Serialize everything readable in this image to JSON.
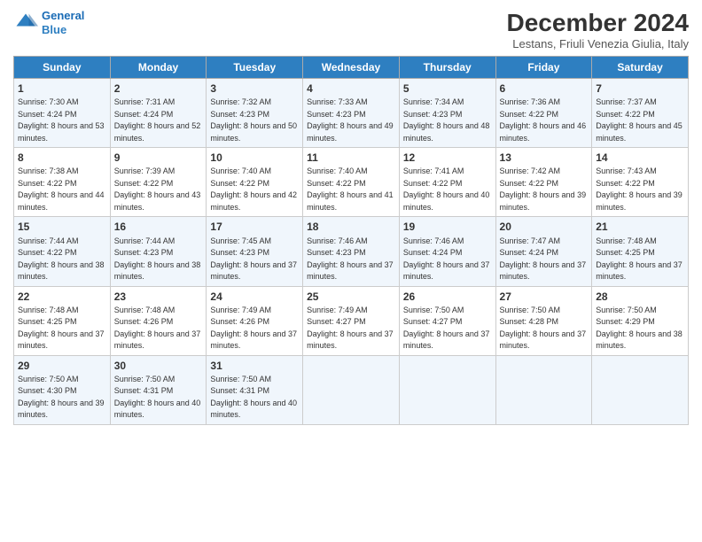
{
  "logo": {
    "line1": "General",
    "line2": "Blue"
  },
  "title": "December 2024",
  "subtitle": "Lestans, Friuli Venezia Giulia, Italy",
  "days_of_week": [
    "Sunday",
    "Monday",
    "Tuesday",
    "Wednesday",
    "Thursday",
    "Friday",
    "Saturday"
  ],
  "weeks": [
    [
      {
        "day": "1",
        "detail": "Sunrise: 7:30 AM\nSunset: 4:24 PM\nDaylight: 8 hours and 53 minutes."
      },
      {
        "day": "2",
        "detail": "Sunrise: 7:31 AM\nSunset: 4:24 PM\nDaylight: 8 hours and 52 minutes."
      },
      {
        "day": "3",
        "detail": "Sunrise: 7:32 AM\nSunset: 4:23 PM\nDaylight: 8 hours and 50 minutes."
      },
      {
        "day": "4",
        "detail": "Sunrise: 7:33 AM\nSunset: 4:23 PM\nDaylight: 8 hours and 49 minutes."
      },
      {
        "day": "5",
        "detail": "Sunrise: 7:34 AM\nSunset: 4:23 PM\nDaylight: 8 hours and 48 minutes."
      },
      {
        "day": "6",
        "detail": "Sunrise: 7:36 AM\nSunset: 4:22 PM\nDaylight: 8 hours and 46 minutes."
      },
      {
        "day": "7",
        "detail": "Sunrise: 7:37 AM\nSunset: 4:22 PM\nDaylight: 8 hours and 45 minutes."
      }
    ],
    [
      {
        "day": "8",
        "detail": "Sunrise: 7:38 AM\nSunset: 4:22 PM\nDaylight: 8 hours and 44 minutes."
      },
      {
        "day": "9",
        "detail": "Sunrise: 7:39 AM\nSunset: 4:22 PM\nDaylight: 8 hours and 43 minutes."
      },
      {
        "day": "10",
        "detail": "Sunrise: 7:40 AM\nSunset: 4:22 PM\nDaylight: 8 hours and 42 minutes."
      },
      {
        "day": "11",
        "detail": "Sunrise: 7:40 AM\nSunset: 4:22 PM\nDaylight: 8 hours and 41 minutes."
      },
      {
        "day": "12",
        "detail": "Sunrise: 7:41 AM\nSunset: 4:22 PM\nDaylight: 8 hours and 40 minutes."
      },
      {
        "day": "13",
        "detail": "Sunrise: 7:42 AM\nSunset: 4:22 PM\nDaylight: 8 hours and 39 minutes."
      },
      {
        "day": "14",
        "detail": "Sunrise: 7:43 AM\nSunset: 4:22 PM\nDaylight: 8 hours and 39 minutes."
      }
    ],
    [
      {
        "day": "15",
        "detail": "Sunrise: 7:44 AM\nSunset: 4:22 PM\nDaylight: 8 hours and 38 minutes."
      },
      {
        "day": "16",
        "detail": "Sunrise: 7:44 AM\nSunset: 4:23 PM\nDaylight: 8 hours and 38 minutes."
      },
      {
        "day": "17",
        "detail": "Sunrise: 7:45 AM\nSunset: 4:23 PM\nDaylight: 8 hours and 37 minutes."
      },
      {
        "day": "18",
        "detail": "Sunrise: 7:46 AM\nSunset: 4:23 PM\nDaylight: 8 hours and 37 minutes."
      },
      {
        "day": "19",
        "detail": "Sunrise: 7:46 AM\nSunset: 4:24 PM\nDaylight: 8 hours and 37 minutes."
      },
      {
        "day": "20",
        "detail": "Sunrise: 7:47 AM\nSunset: 4:24 PM\nDaylight: 8 hours and 37 minutes."
      },
      {
        "day": "21",
        "detail": "Sunrise: 7:48 AM\nSunset: 4:25 PM\nDaylight: 8 hours and 37 minutes."
      }
    ],
    [
      {
        "day": "22",
        "detail": "Sunrise: 7:48 AM\nSunset: 4:25 PM\nDaylight: 8 hours and 37 minutes."
      },
      {
        "day": "23",
        "detail": "Sunrise: 7:48 AM\nSunset: 4:26 PM\nDaylight: 8 hours and 37 minutes."
      },
      {
        "day": "24",
        "detail": "Sunrise: 7:49 AM\nSunset: 4:26 PM\nDaylight: 8 hours and 37 minutes."
      },
      {
        "day": "25",
        "detail": "Sunrise: 7:49 AM\nSunset: 4:27 PM\nDaylight: 8 hours and 37 minutes."
      },
      {
        "day": "26",
        "detail": "Sunrise: 7:50 AM\nSunset: 4:27 PM\nDaylight: 8 hours and 37 minutes."
      },
      {
        "day": "27",
        "detail": "Sunrise: 7:50 AM\nSunset: 4:28 PM\nDaylight: 8 hours and 37 minutes."
      },
      {
        "day": "28",
        "detail": "Sunrise: 7:50 AM\nSunset: 4:29 PM\nDaylight: 8 hours and 38 minutes."
      }
    ],
    [
      {
        "day": "29",
        "detail": "Sunrise: 7:50 AM\nSunset: 4:30 PM\nDaylight: 8 hours and 39 minutes."
      },
      {
        "day": "30",
        "detail": "Sunrise: 7:50 AM\nSunset: 4:31 PM\nDaylight: 8 hours and 40 minutes."
      },
      {
        "day": "31",
        "detail": "Sunrise: 7:50 AM\nSunset: 4:31 PM\nDaylight: 8 hours and 40 minutes."
      },
      null,
      null,
      null,
      null
    ]
  ]
}
